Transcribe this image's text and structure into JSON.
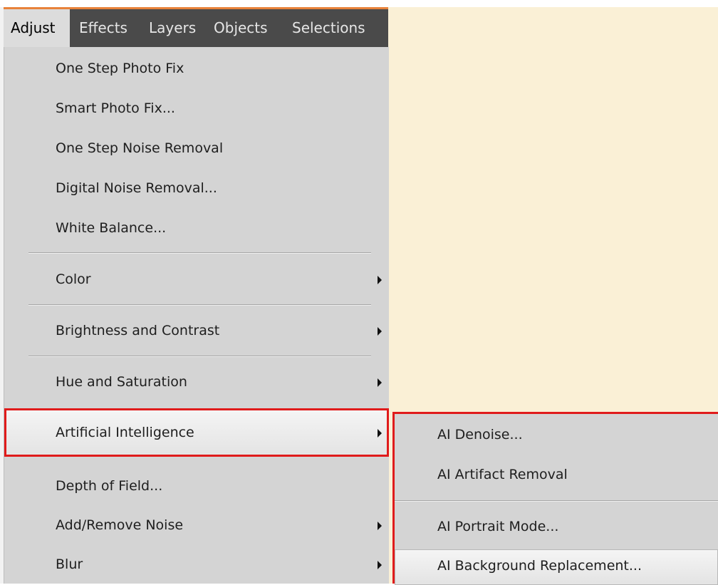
{
  "menubar": {
    "items": [
      {
        "label": "Adjust"
      },
      {
        "label": "Effects"
      },
      {
        "label": "Layers"
      },
      {
        "label": "Objects"
      },
      {
        "label": "Selections"
      }
    ]
  },
  "adjust_menu": {
    "items": [
      {
        "label": "One Step Photo Fix"
      },
      {
        "label": "Smart Photo Fix..."
      },
      {
        "label": "One Step Noise Removal"
      },
      {
        "label": "Digital Noise Removal..."
      },
      {
        "label": "White Balance..."
      },
      {
        "label": "Color"
      },
      {
        "label": "Brightness and Contrast"
      },
      {
        "label": "Hue and Saturation"
      },
      {
        "label": "Artificial Intelligence"
      },
      {
        "label": "Depth of Field..."
      },
      {
        "label": "Add/Remove Noise"
      },
      {
        "label": "Blur"
      }
    ]
  },
  "ai_submenu": {
    "items": [
      {
        "label": "AI Denoise..."
      },
      {
        "label": "AI Artifact Removal"
      },
      {
        "label": "AI Portrait Mode..."
      },
      {
        "label": "AI Background Replacement..."
      }
    ]
  },
  "colors": {
    "menu_bg": "#d4d4d4",
    "menubar_bg": "#4a4a4a",
    "canvas_bg": "#faf0d6",
    "highlight_border": "#e01b1b"
  }
}
